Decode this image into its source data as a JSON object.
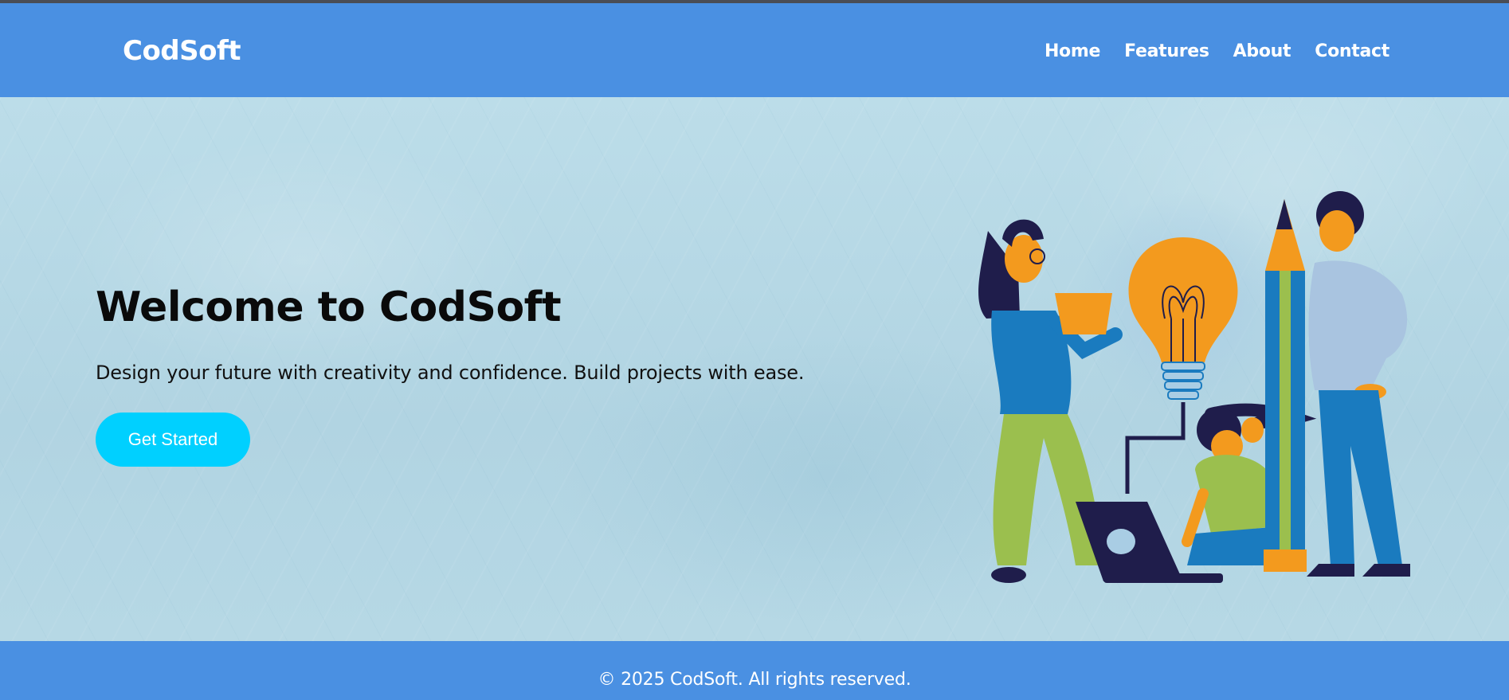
{
  "header": {
    "logo": "CodSoft",
    "nav": [
      "Home",
      "Features",
      "About",
      "Contact"
    ]
  },
  "hero": {
    "title": "Welcome to CodSoft",
    "subtitle": "Design your future with creativity and confidence. Build projects with ease.",
    "cta_label": "Get Started",
    "illustration": "team-creativity-illustration"
  },
  "footer": {
    "copyright": "© 2025 CodSoft. All rights reserved."
  },
  "colors": {
    "primary": "#4a90e2",
    "cta": "#00d0ff",
    "hero_bg": "#b7d9e6",
    "text_dark": "#0a0a0a"
  }
}
